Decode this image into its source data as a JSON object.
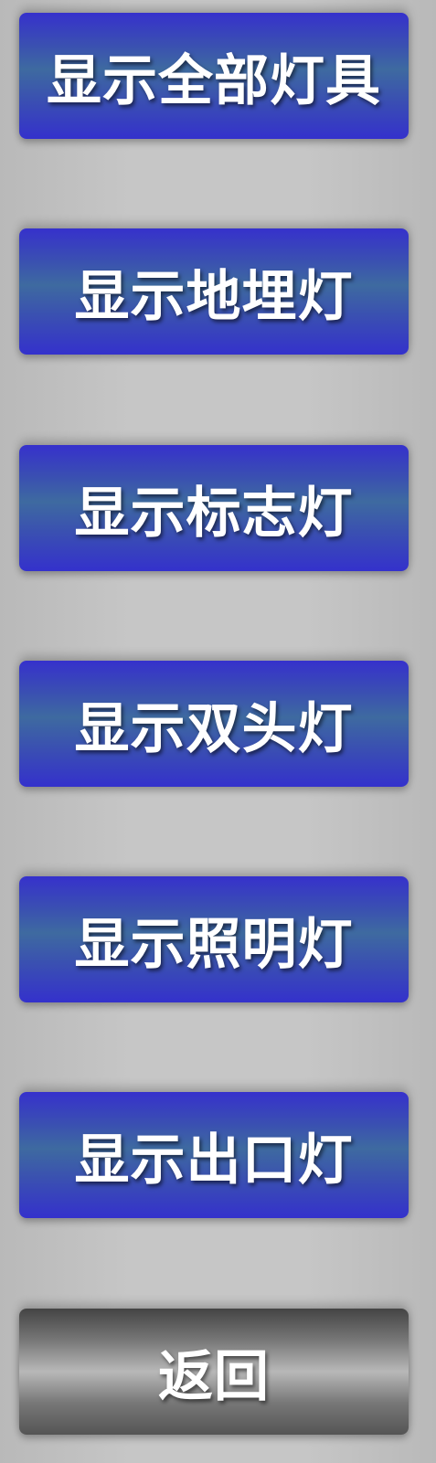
{
  "menu": {
    "buttons": [
      {
        "label": "显示全部灯具"
      },
      {
        "label": "显示地埋灯"
      },
      {
        "label": "显示标志灯"
      },
      {
        "label": "显示双头灯"
      },
      {
        "label": "显示照明灯"
      },
      {
        "label": "显示出口灯"
      }
    ],
    "back_label": "返回"
  },
  "colors": {
    "button_blue": "#3631cc",
    "button_blue_mid": "#3e6aa0",
    "back_button_gray": "#777777",
    "background": "#c4c4c4",
    "label_text": "#ffffff"
  }
}
